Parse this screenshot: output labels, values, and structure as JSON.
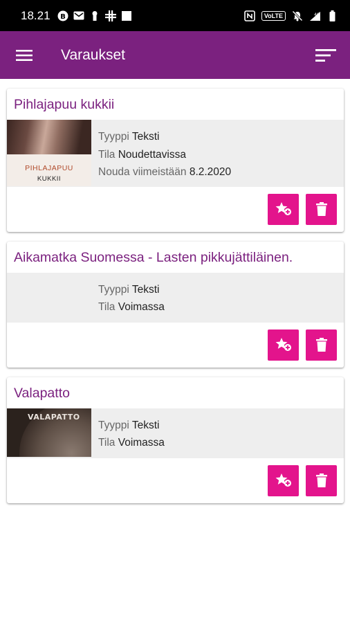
{
  "status_bar": {
    "time": "18.21",
    "volte": "VoLTE",
    "network": "4G"
  },
  "app_bar": {
    "title": "Varaukset",
    "menu_icon": "hamburger-menu-icon",
    "sort_icon": "sort-icon"
  },
  "colors": {
    "app_bar": "#7b217f",
    "accent": "#e3148c",
    "title_text": "#7b217f"
  },
  "labels": {
    "type": "Tyyppi",
    "status": "Tila",
    "pickup_by": "Nouda viimeistään"
  },
  "reservations": [
    {
      "title": "Pihlajapuu kukkii",
      "cover_text_1": "PIHLAJAPUU",
      "cover_text_2": "KUKKII",
      "type": "Teksti",
      "status": "Noudettavissa",
      "pickup_by": "8.2.2020"
    },
    {
      "title": "Aikamatka Suomessa - Lasten pikkujättiläinen.",
      "type": "Teksti",
      "status": "Voimassa"
    },
    {
      "title": "Valapatto",
      "cover_text_1": "VALAPATTO",
      "type": "Teksti",
      "status": "Voimassa"
    }
  ]
}
